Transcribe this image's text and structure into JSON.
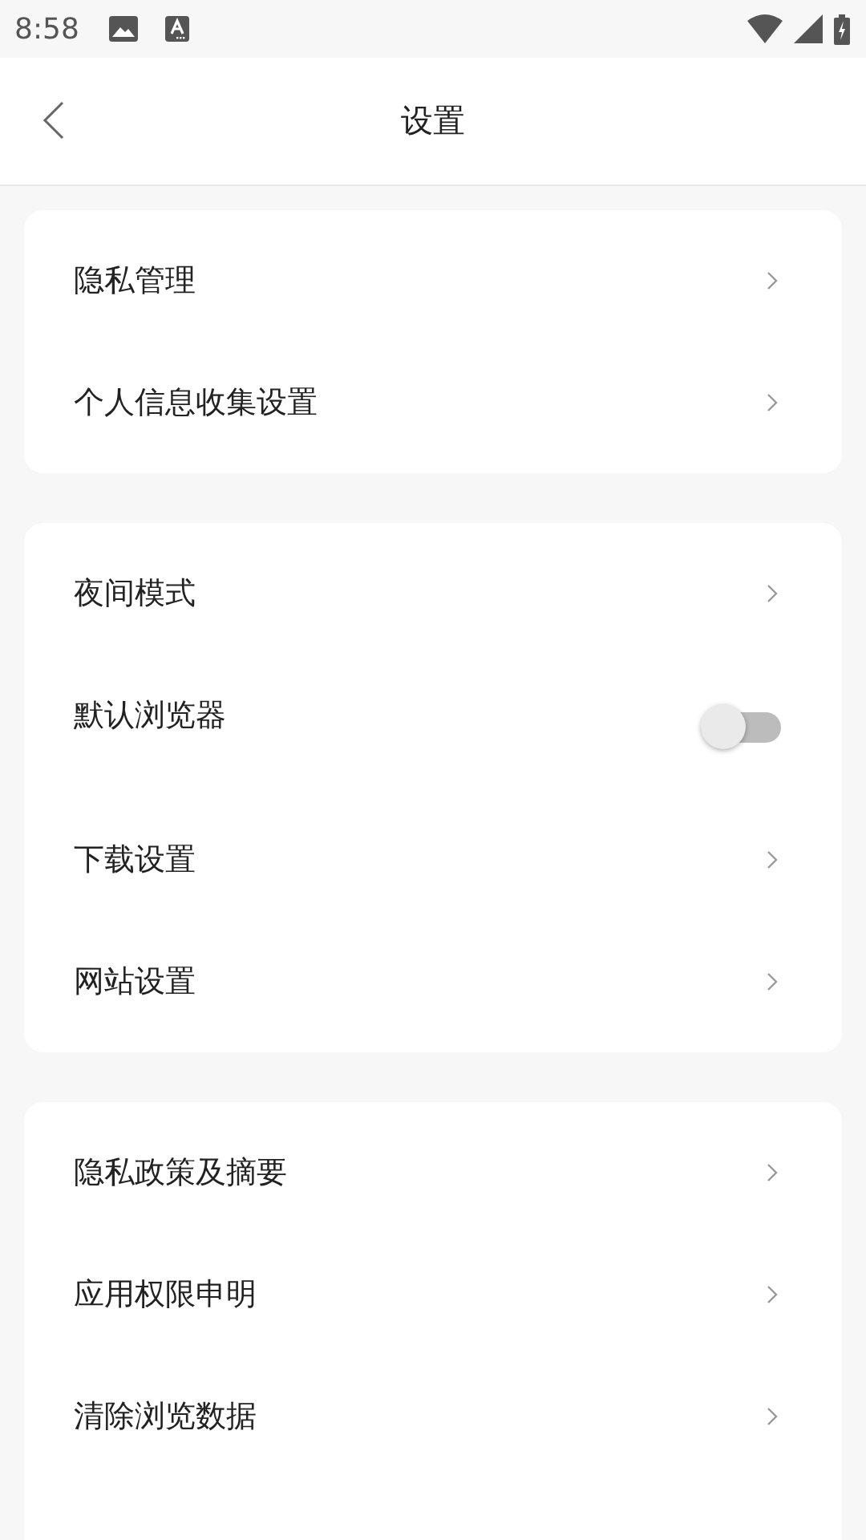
{
  "status_bar": {
    "time": "8:58"
  },
  "header": {
    "title": "设置"
  },
  "groups": [
    {
      "items": [
        {
          "kind": "link",
          "label": "隐私管理"
        },
        {
          "kind": "link",
          "label": "个人信息收集设置"
        }
      ]
    },
    {
      "items": [
        {
          "kind": "link",
          "label": "夜间模式"
        },
        {
          "kind": "switch",
          "label": "默认浏览器",
          "on": false
        },
        {
          "kind": "link",
          "label": "下载设置"
        },
        {
          "kind": "link",
          "label": "网站设置"
        }
      ]
    },
    {
      "items": [
        {
          "kind": "link",
          "label": "隐私政策及摘要"
        },
        {
          "kind": "link",
          "label": "应用权限申明"
        },
        {
          "kind": "link",
          "label": "清除浏览数据"
        }
      ]
    }
  ]
}
